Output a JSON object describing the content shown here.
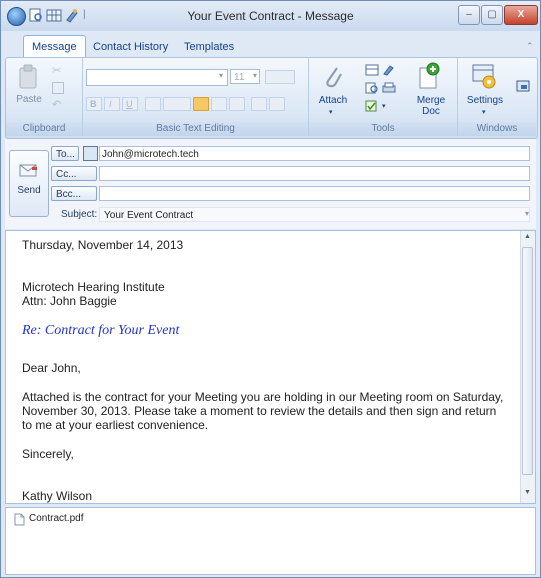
{
  "window": {
    "title": "Your Event Contract - Message",
    "controls": [
      "minimize-icon",
      "maximize-icon",
      "close-icon"
    ],
    "quick_access": [
      "print-preview-icon",
      "grid-icon",
      "brush-icon"
    ],
    "quick_access_sep": "|"
  },
  "tabs": [
    {
      "label": "Message",
      "active": true
    },
    {
      "label": "Contact History",
      "active": false
    },
    {
      "label": "Templates",
      "active": false
    }
  ],
  "ribbon": {
    "clipboard": {
      "label": "Clipboard",
      "paste": "Paste"
    },
    "text": {
      "label": "Basic Text Editing",
      "font_size": "11",
      "buttons": [
        "B",
        "I",
        "U"
      ]
    },
    "tools": {
      "label": "Tools",
      "attach": "Attach",
      "merge": "Merge",
      "merge2": "Doc"
    },
    "windows": {
      "label": "Windows",
      "settings": "Settings"
    }
  },
  "header": {
    "send": "Send",
    "to_label": "To...",
    "cc_label": "Cc...",
    "bcc_label": "Bcc...",
    "to_value": "John@microtech.tech",
    "cc_value": "",
    "bcc_value": "",
    "subject_label": "Subject:",
    "subject_value": "Your Event Contract"
  },
  "message": {
    "date": "Thursday, November 14, 2013",
    "company": "Microtech Hearing Institute",
    "attn": "Attn:  John Baggie",
    "re": "Re:  Contract for Your Event",
    "greeting": "Dear John,",
    "p1": "Attached is the contract for your Meeting you are holding in our Meeting room on Saturday,",
    "p2": "November 30, 2013.  Please take a moment to review the details and then sign and return",
    "p3": "to me at your earliest convenience.",
    "closing": "Sincerely,",
    "signer": "Kathy Wilson"
  },
  "attachments": [
    {
      "name": "Contract.pdf"
    }
  ],
  "colors": {
    "accent": "#15428b",
    "re_text": "#2233cc"
  }
}
